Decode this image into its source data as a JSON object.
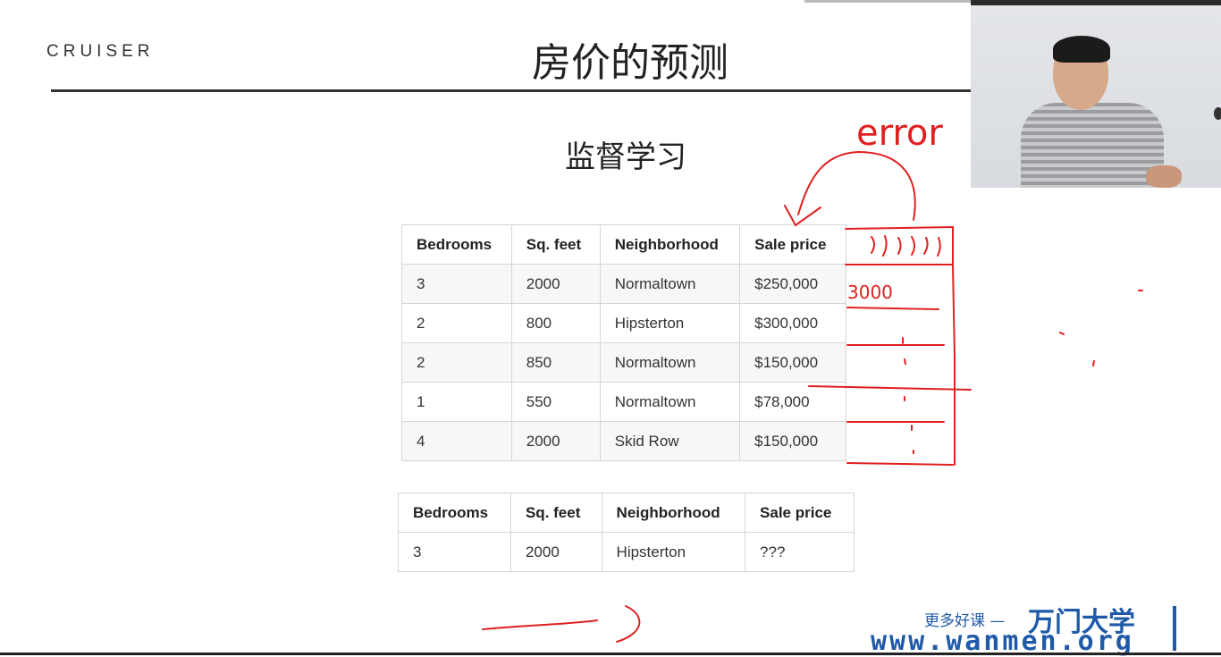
{
  "header": {
    "logo": "CRUISER",
    "title": "房价的预测"
  },
  "subtitle": "监督学习",
  "training_table": {
    "headers": [
      "Bedrooms",
      "Sq. feet",
      "Neighborhood",
      "Sale price"
    ],
    "rows": [
      [
        "3",
        "2000",
        "Normaltown",
        "$250,000"
      ],
      [
        "2",
        "800",
        "Hipsterton",
        "$300,000"
      ],
      [
        "2",
        "850",
        "Normaltown",
        "$150,000"
      ],
      [
        "1",
        "550",
        "Normaltown",
        "$78,000"
      ],
      [
        "4",
        "2000",
        "Skid Row",
        "$150,000"
      ]
    ]
  },
  "query_table": {
    "headers": [
      "Bedrooms",
      "Sq. feet",
      "Neighborhood",
      "Sale price"
    ],
    "rows": [
      [
        "3",
        "2000",
        "Hipsterton",
        "???"
      ]
    ]
  },
  "annotations": {
    "error_label": "error",
    "handwritten_value": "3000",
    "color": "#e02020"
  },
  "watermark": {
    "tagline": "更多好课 —",
    "brand": "万门大学",
    "url": "www.wanmen.org",
    "color": "#1f5aa8"
  }
}
